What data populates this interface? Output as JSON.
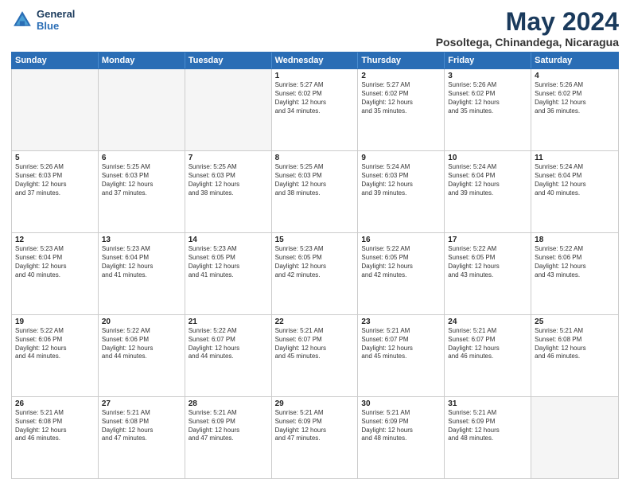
{
  "logo": {
    "line1": "General",
    "line2": "Blue"
  },
  "title": "May 2024",
  "location": "Posoltega, Chinandega, Nicaragua",
  "header_days": [
    "Sunday",
    "Monday",
    "Tuesday",
    "Wednesday",
    "Thursday",
    "Friday",
    "Saturday"
  ],
  "weeks": [
    [
      {
        "day": "",
        "text": ""
      },
      {
        "day": "",
        "text": ""
      },
      {
        "day": "",
        "text": ""
      },
      {
        "day": "1",
        "text": "Sunrise: 5:27 AM\nSunset: 6:02 PM\nDaylight: 12 hours\nand 34 minutes."
      },
      {
        "day": "2",
        "text": "Sunrise: 5:27 AM\nSunset: 6:02 PM\nDaylight: 12 hours\nand 35 minutes."
      },
      {
        "day": "3",
        "text": "Sunrise: 5:26 AM\nSunset: 6:02 PM\nDaylight: 12 hours\nand 35 minutes."
      },
      {
        "day": "4",
        "text": "Sunrise: 5:26 AM\nSunset: 6:02 PM\nDaylight: 12 hours\nand 36 minutes."
      }
    ],
    [
      {
        "day": "5",
        "text": "Sunrise: 5:26 AM\nSunset: 6:03 PM\nDaylight: 12 hours\nand 37 minutes."
      },
      {
        "day": "6",
        "text": "Sunrise: 5:25 AM\nSunset: 6:03 PM\nDaylight: 12 hours\nand 37 minutes."
      },
      {
        "day": "7",
        "text": "Sunrise: 5:25 AM\nSunset: 6:03 PM\nDaylight: 12 hours\nand 38 minutes."
      },
      {
        "day": "8",
        "text": "Sunrise: 5:25 AM\nSunset: 6:03 PM\nDaylight: 12 hours\nand 38 minutes."
      },
      {
        "day": "9",
        "text": "Sunrise: 5:24 AM\nSunset: 6:03 PM\nDaylight: 12 hours\nand 39 minutes."
      },
      {
        "day": "10",
        "text": "Sunrise: 5:24 AM\nSunset: 6:04 PM\nDaylight: 12 hours\nand 39 minutes."
      },
      {
        "day": "11",
        "text": "Sunrise: 5:24 AM\nSunset: 6:04 PM\nDaylight: 12 hours\nand 40 minutes."
      }
    ],
    [
      {
        "day": "12",
        "text": "Sunrise: 5:23 AM\nSunset: 6:04 PM\nDaylight: 12 hours\nand 40 minutes."
      },
      {
        "day": "13",
        "text": "Sunrise: 5:23 AM\nSunset: 6:04 PM\nDaylight: 12 hours\nand 41 minutes."
      },
      {
        "day": "14",
        "text": "Sunrise: 5:23 AM\nSunset: 6:05 PM\nDaylight: 12 hours\nand 41 minutes."
      },
      {
        "day": "15",
        "text": "Sunrise: 5:23 AM\nSunset: 6:05 PM\nDaylight: 12 hours\nand 42 minutes."
      },
      {
        "day": "16",
        "text": "Sunrise: 5:22 AM\nSunset: 6:05 PM\nDaylight: 12 hours\nand 42 minutes."
      },
      {
        "day": "17",
        "text": "Sunrise: 5:22 AM\nSunset: 6:05 PM\nDaylight: 12 hours\nand 43 minutes."
      },
      {
        "day": "18",
        "text": "Sunrise: 5:22 AM\nSunset: 6:06 PM\nDaylight: 12 hours\nand 43 minutes."
      }
    ],
    [
      {
        "day": "19",
        "text": "Sunrise: 5:22 AM\nSunset: 6:06 PM\nDaylight: 12 hours\nand 44 minutes."
      },
      {
        "day": "20",
        "text": "Sunrise: 5:22 AM\nSunset: 6:06 PM\nDaylight: 12 hours\nand 44 minutes."
      },
      {
        "day": "21",
        "text": "Sunrise: 5:22 AM\nSunset: 6:07 PM\nDaylight: 12 hours\nand 44 minutes."
      },
      {
        "day": "22",
        "text": "Sunrise: 5:21 AM\nSunset: 6:07 PM\nDaylight: 12 hours\nand 45 minutes."
      },
      {
        "day": "23",
        "text": "Sunrise: 5:21 AM\nSunset: 6:07 PM\nDaylight: 12 hours\nand 45 minutes."
      },
      {
        "day": "24",
        "text": "Sunrise: 5:21 AM\nSunset: 6:07 PM\nDaylight: 12 hours\nand 46 minutes."
      },
      {
        "day": "25",
        "text": "Sunrise: 5:21 AM\nSunset: 6:08 PM\nDaylight: 12 hours\nand 46 minutes."
      }
    ],
    [
      {
        "day": "26",
        "text": "Sunrise: 5:21 AM\nSunset: 6:08 PM\nDaylight: 12 hours\nand 46 minutes."
      },
      {
        "day": "27",
        "text": "Sunrise: 5:21 AM\nSunset: 6:08 PM\nDaylight: 12 hours\nand 47 minutes."
      },
      {
        "day": "28",
        "text": "Sunrise: 5:21 AM\nSunset: 6:09 PM\nDaylight: 12 hours\nand 47 minutes."
      },
      {
        "day": "29",
        "text": "Sunrise: 5:21 AM\nSunset: 6:09 PM\nDaylight: 12 hours\nand 47 minutes."
      },
      {
        "day": "30",
        "text": "Sunrise: 5:21 AM\nSunset: 6:09 PM\nDaylight: 12 hours\nand 48 minutes."
      },
      {
        "day": "31",
        "text": "Sunrise: 5:21 AM\nSunset: 6:09 PM\nDaylight: 12 hours\nand 48 minutes."
      },
      {
        "day": "",
        "text": ""
      }
    ]
  ]
}
